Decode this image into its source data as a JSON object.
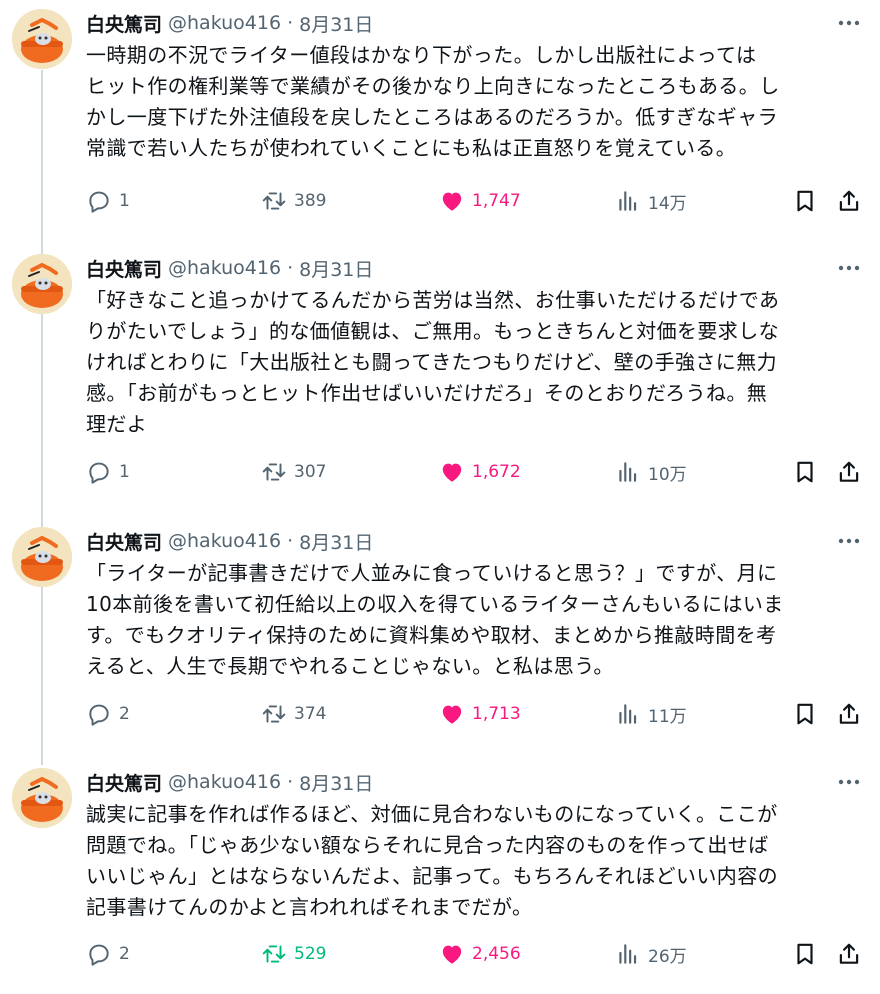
{
  "author": {
    "name": "白央篤司",
    "handle": "@hakuo416",
    "separator": "·"
  },
  "colors": {
    "like": "#f91880",
    "retweet_active": "#00ba7c",
    "secondary": "#536471",
    "thread_line": "#cfd9de"
  },
  "icons": {
    "more": "more-horizontal-icon",
    "reply": "reply-bubble-icon",
    "retweet": "retweet-icon",
    "like": "heart-filled-icon",
    "views": "views-bar-chart-icon",
    "bookmark": "bookmark-icon",
    "share": "share-upload-icon"
  },
  "tweets": [
    {
      "date": "8月31日",
      "text": "一時期の不況でライター値段はかなり下がった。しかし出版社によっては\nヒット作の権利業等で業績がその後かなり上向きになったところもある。し\nかし一度下げた外注値段を戻したところはあるのだろうか。低すぎなギャラ\n常識で若い人たちが使われていくことにも私は正直怒りを覚えている。",
      "replies": "1",
      "retweets": "389",
      "likes": "1,747",
      "views": "14万",
      "liked": true,
      "retweeted": false
    },
    {
      "date": "8月31日",
      "text": "「好きなこと追っかけてるんだから苦労は当然、お仕事いただけるだけであ\nりがたいでしょう」的な価値観は、ご無用。もっときちんと対価を要求しな\nければとわりに「大出版社とも闘ってきたつもりだけど、壁の手強さに無力\n感。「お前がもっとヒット作出せばいいだけだろ」そのとおりだろうね。無\n理だよ",
      "replies": "1",
      "retweets": "307",
      "likes": "1,672",
      "views": "10万",
      "liked": true,
      "retweeted": false
    },
    {
      "date": "8月31日",
      "text": "「ライターが記事書きだけで人並みに食っていけると思う？」ですが、月に\n10本前後を書いて初任給以上の収入を得ているライターさんもいるにはいま\nす。でもクオリティ保持のために資料集めや取材、まとめから推敲時間を考\nえると、人生で長期でやれることじゃない。と私は思う。",
      "replies": "2",
      "retweets": "374",
      "likes": "1,713",
      "views": "11万",
      "liked": true,
      "retweeted": false
    },
    {
      "date": "8月31日",
      "text": "誠実に記事を作れば作るほど、対価に見合わないものになっていく。ここが\n問題でね。「じゃあ少ない額ならそれに見合った内容のものを作って出せば\nいいじゃん」とはならないんだよ、記事って。もちろんそれほどいい内容の\n記事書けてんのかよと言われればそれまでだが。",
      "replies": "2",
      "retweets": "529",
      "likes": "2,456",
      "views": "26万",
      "liked": true,
      "retweeted": true
    }
  ]
}
